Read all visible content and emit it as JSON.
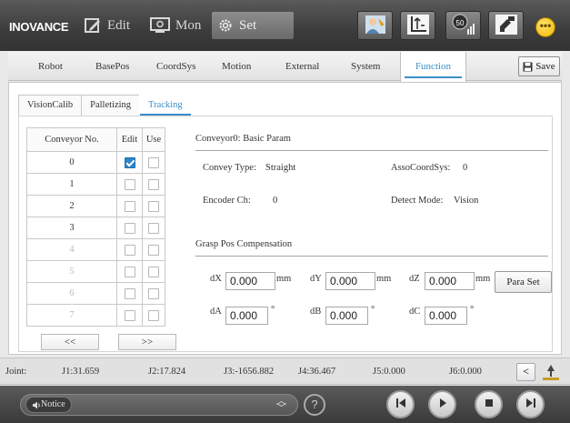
{
  "header": {
    "brand": "INOVANCE",
    "modes": [
      {
        "label": "Edit",
        "icon": "pencil-icon"
      },
      {
        "label": "Mon",
        "icon": "monitor-icon"
      },
      {
        "label": "Set",
        "icon": "gear-icon"
      }
    ],
    "toolbar_icons": [
      "robot-user-icon",
      "axis-coordinate-icon",
      "speed-level-icon",
      "tool-tcp-icon",
      "more-icon"
    ],
    "speed_value": "50",
    "more_glyph": "•••"
  },
  "tabs": {
    "items": [
      "Robot",
      "BasePos",
      "CoordSys",
      "Motion",
      "External",
      "System",
      "Function"
    ],
    "active": "Function",
    "save_label": "Save"
  },
  "subtabs": {
    "items": [
      "VisionCalib",
      "Palletizing",
      "Tracking"
    ],
    "active": "Tracking"
  },
  "conveyor_table": {
    "headers": [
      "Conveyor No.",
      "Edit",
      "Use"
    ],
    "rows": [
      {
        "no": "0",
        "edit": true,
        "use": false,
        "enabled": true
      },
      {
        "no": "1",
        "edit": false,
        "use": false,
        "enabled": true
      },
      {
        "no": "2",
        "edit": false,
        "use": false,
        "enabled": true
      },
      {
        "no": "3",
        "edit": false,
        "use": false,
        "enabled": true
      },
      {
        "no": "4",
        "edit": false,
        "use": false,
        "enabled": false
      },
      {
        "no": "5",
        "edit": false,
        "use": false,
        "enabled": false
      },
      {
        "no": "6",
        "edit": false,
        "use": false,
        "enabled": false
      },
      {
        "no": "7",
        "edit": false,
        "use": false,
        "enabled": false
      }
    ],
    "prev_label": "<<",
    "next_label": ">>"
  },
  "basic_param": {
    "title": "Conveyor0: Basic Param",
    "convey_type_label": "Convey Type:",
    "convey_type_value": "Straight",
    "asso_label": "AssoCoordSys:",
    "asso_value": "0",
    "encoder_label": "Encoder Ch:",
    "encoder_value": "0",
    "detect_label": "Detect Mode:",
    "detect_value": "Vision"
  },
  "grasp": {
    "title": "Grasp Pos Compensation",
    "dx": {
      "label": "dX",
      "value": "0.000",
      "unit": "mm"
    },
    "dy": {
      "label": "dY",
      "value": "0.000",
      "unit": "mm"
    },
    "dz": {
      "label": "dZ",
      "value": "0.000",
      "unit": "mm"
    },
    "da": {
      "label": "dA",
      "value": "0.000",
      "unit": "°"
    },
    "db": {
      "label": "dB",
      "value": "0.000",
      "unit": "°"
    },
    "dc": {
      "label": "dC",
      "value": "0.000",
      "unit": "°"
    },
    "para_set_label": "Para Set"
  },
  "joint": {
    "label": "Joint:",
    "values": [
      "J1:31.659",
      "J2:17.824",
      "J3:-1656.882",
      "J4:36.467",
      "J5:0.000",
      "J6:0.000"
    ],
    "nav_label": "<"
  },
  "bottom": {
    "notice_label": "Notice",
    "help_label": "?",
    "buttons": [
      "skip-back-icon",
      "play-icon",
      "stop-icon",
      "step-forward-icon"
    ]
  },
  "colors": {
    "accent": "#3a8fc7",
    "checkbox_checked": "#2a86c9",
    "topbar": "#3c3c3c",
    "more_button": "#f0b400"
  }
}
